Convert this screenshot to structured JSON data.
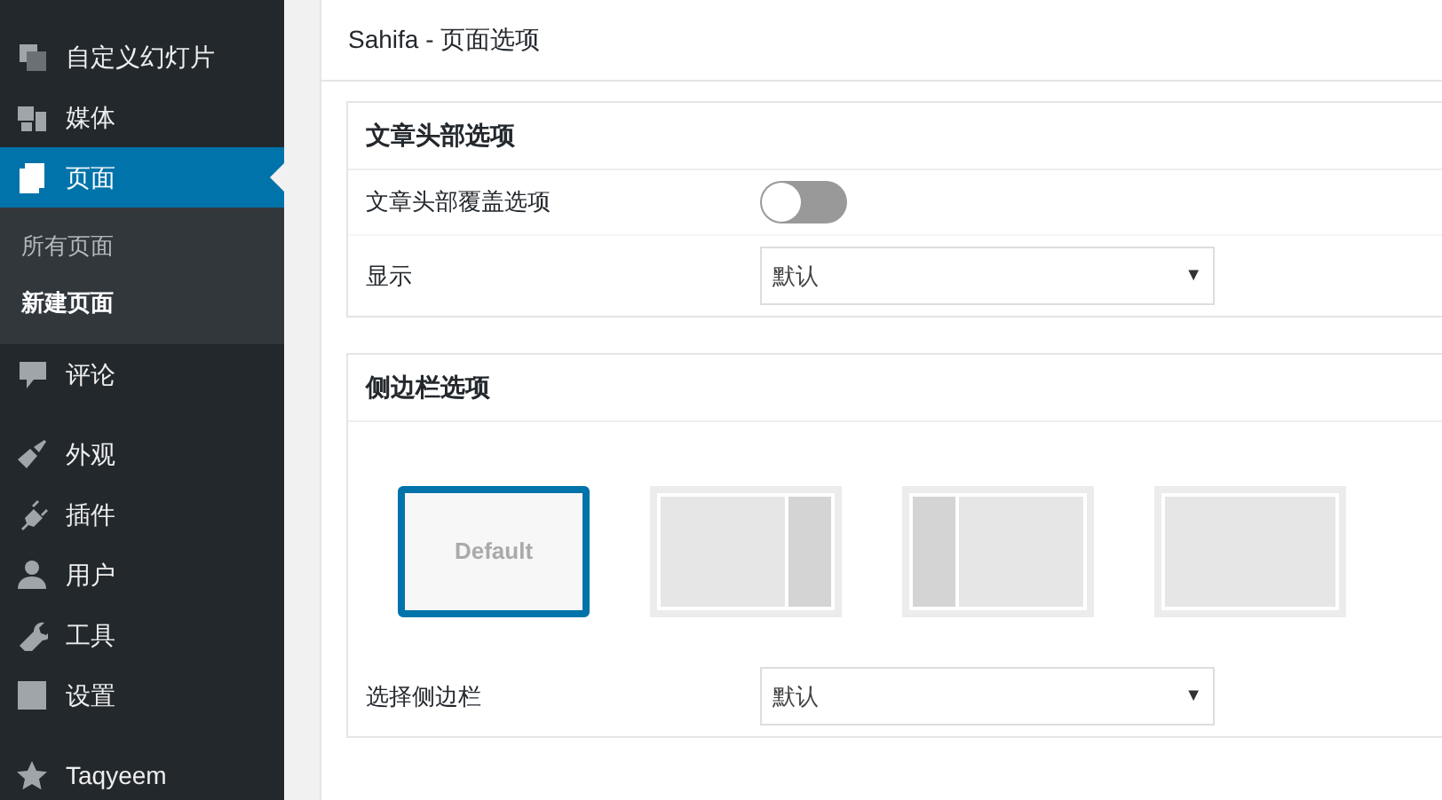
{
  "sidebar": {
    "items": [
      {
        "label": "自定义幻灯片",
        "selected": false
      },
      {
        "label": "媒体",
        "selected": false
      },
      {
        "label": "页面",
        "selected": true,
        "children": [
          {
            "label": "所有页面",
            "selected": false
          },
          {
            "label": "新建页面",
            "selected": true
          }
        ]
      },
      {
        "label": "评论",
        "selected": false,
        "gap_after": true
      },
      {
        "label": "外观",
        "selected": false
      },
      {
        "label": "插件",
        "selected": false
      },
      {
        "label": "用户",
        "selected": false
      },
      {
        "label": "工具",
        "selected": false
      },
      {
        "label": "设置",
        "selected": false,
        "gap_after": true
      },
      {
        "label": "Taqyeem",
        "selected": false
      }
    ]
  },
  "panel": {
    "title": "Sahifa - 页面选项",
    "sections": [
      {
        "title": "文章头部选项",
        "rows": [
          {
            "kind": "toggle",
            "label": "文章头部覆盖选项",
            "on": false
          },
          {
            "kind": "select",
            "label": "显示",
            "value": "默认",
            "caret": "▼"
          }
        ]
      },
      {
        "title": "侧边栏选项",
        "layouts": [
          {
            "kind": "default",
            "label": "Default",
            "selected": true
          },
          {
            "kind": "right",
            "selected": false
          },
          {
            "kind": "left",
            "selected": false
          },
          {
            "kind": "none",
            "selected": false
          }
        ],
        "rows": [
          {
            "kind": "select",
            "label": "选择侧边栏",
            "value": "默认",
            "caret": "▼"
          }
        ]
      }
    ]
  }
}
